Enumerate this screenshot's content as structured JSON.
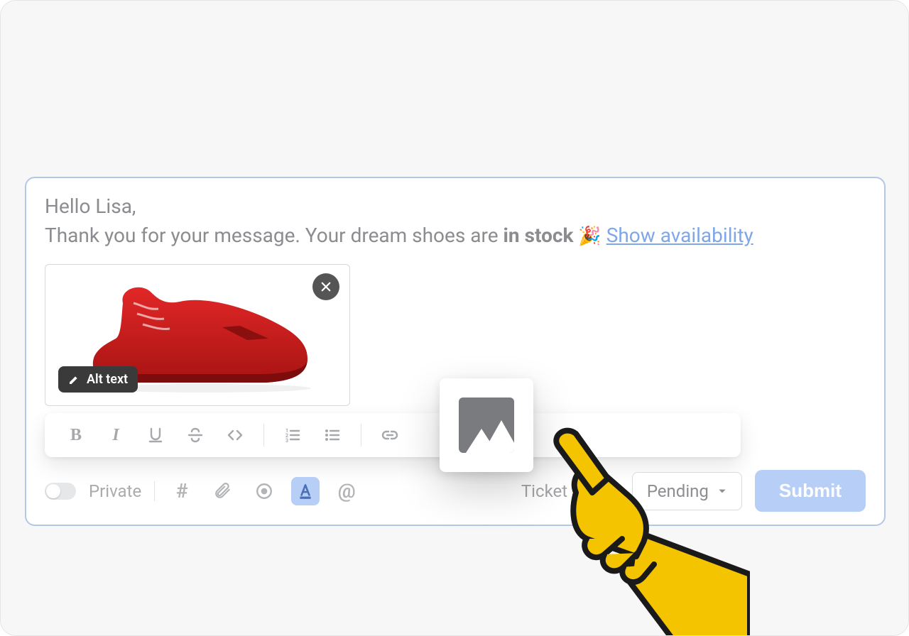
{
  "message": {
    "greeting": "Hello Lisa,",
    "body_prefix": "Thank you for your message.  Your dream shoes are ",
    "stock_status": "in stock",
    "emoji": "🎉",
    "link_text": "Show availability"
  },
  "attachment": {
    "alt_label": "Alt text",
    "remove_aria": "Remove image"
  },
  "toolbar": {
    "bold": "B",
    "italic": "I"
  },
  "footer": {
    "private_label": "Private",
    "hash": "#",
    "mention": "@",
    "ticket_status_label": "Ticket status",
    "status_value": "Pending",
    "submit_label": "Submit"
  },
  "popup": {
    "insert_image_aria": "Insert image"
  }
}
